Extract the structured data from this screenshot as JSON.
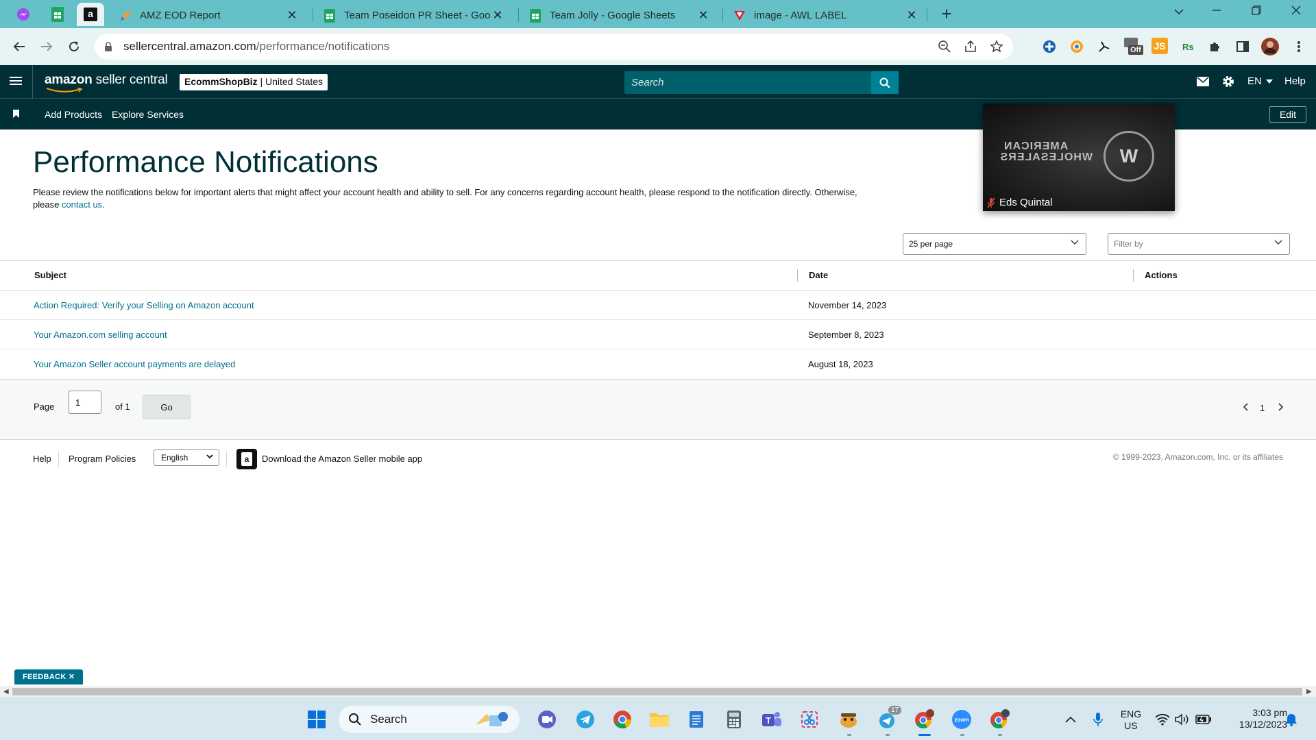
{
  "browser": {
    "tabs": [
      {
        "title": "AMZ EOD Report"
      },
      {
        "title": "Team Poseidon PR Sheet - Goog"
      },
      {
        "title": "Team Jolly - Google Sheets"
      },
      {
        "title": "image - AWL LABEL"
      }
    ],
    "close_glyph": "✕",
    "new_tab_glyph": "+",
    "address": {
      "host": "sellercentral.amazon.com",
      "path": "/performance/notifications"
    },
    "extension_badge": "Off",
    "extension_js": "JS"
  },
  "header": {
    "logo_part1": "amazon",
    "logo_part2": " seller central",
    "store_name": "EcommShopBiz",
    "marketplace": " | United States",
    "search_placeholder": "Search",
    "language": "EN",
    "help": "Help"
  },
  "subnav": {
    "items": [
      {
        "label": "Add Products"
      },
      {
        "label": "Explore Services"
      }
    ],
    "edit_label": "Edit"
  },
  "video_call": {
    "caller_name": "Eds Quintal",
    "logo_line1": "AMERICAN",
    "logo_line2": "WHOLESALERS",
    "logo_mark": "W"
  },
  "page": {
    "title": "Performance Notifications",
    "description": "Please review the notifications below for important alerts that might affect your account health and ability to sell. For any concerns regarding account health, please respond to the notification directly. Otherwise, please ",
    "contact_link": "contact us",
    "description_end": ".",
    "per_page": "25 per page",
    "filter_placeholder": "Filter by"
  },
  "table": {
    "columns": {
      "subject": "Subject",
      "date": "Date",
      "actions": "Actions"
    },
    "rows": [
      {
        "subject": "Action Required: Verify your Selling on Amazon account",
        "date": "November 14, 2023"
      },
      {
        "subject": "Your Amazon.com selling account",
        "date": "September 8, 2023"
      },
      {
        "subject": "Your Amazon Seller account payments are delayed",
        "date": "August 18, 2023"
      }
    ]
  },
  "pagination": {
    "page_label": "Page",
    "page_value": "1",
    "of_label": "of 1",
    "go_label": "Go",
    "current_page": "1"
  },
  "footer": {
    "help": "Help",
    "program_policies": "Program Policies",
    "language": "English",
    "mobile_app": "Download the Amazon Seller mobile app",
    "copyright": "© 1999-2023, Amazon.com, Inc. or its affiliates"
  },
  "feedback": {
    "label": "FEEDBACK ✕"
  },
  "taskbar": {
    "search_label": "Search",
    "telegram_badge": "17",
    "lang_line1": "ENG",
    "lang_line2": "US",
    "time": "3:03 pm",
    "date": "13/12/2023"
  },
  "colors": {
    "tabstrip": "#65c1c7",
    "sc_header": "#002f36",
    "link": "#00718d",
    "search_button": "#008296"
  }
}
